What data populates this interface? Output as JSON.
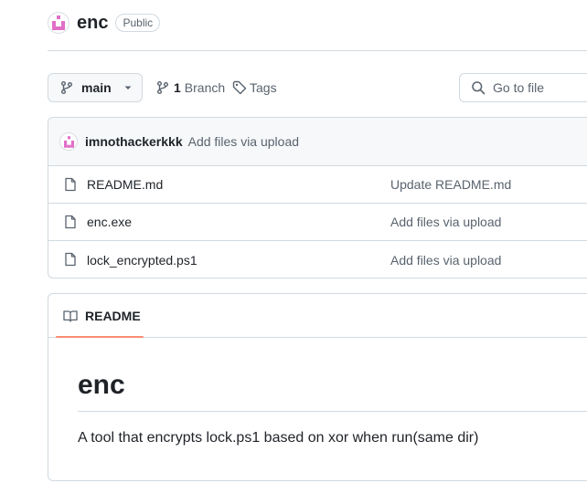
{
  "repo": {
    "name": "enc",
    "visibility": "Public"
  },
  "toolbar": {
    "branch_name": "main",
    "branch_count": "1",
    "branch_label": "Branch",
    "tags_label": "Tags",
    "search_placeholder": "Go to file"
  },
  "latest_commit": {
    "author": "imnothackerkkk",
    "message": "Add files via upload"
  },
  "files": [
    {
      "name": "README.md",
      "commit": "Update README.md"
    },
    {
      "name": "enc.exe",
      "commit": "Add files via upload"
    },
    {
      "name": "lock_encrypted.ps1",
      "commit": "Add files via upload"
    }
  ],
  "readme": {
    "tab_label": "README",
    "title": "enc",
    "description": "A tool that encrypts lock.ps1 based on xor when run(same dir)"
  },
  "colors": {
    "accent_underline": "#fd8c73",
    "avatar": "#e16fc8"
  }
}
